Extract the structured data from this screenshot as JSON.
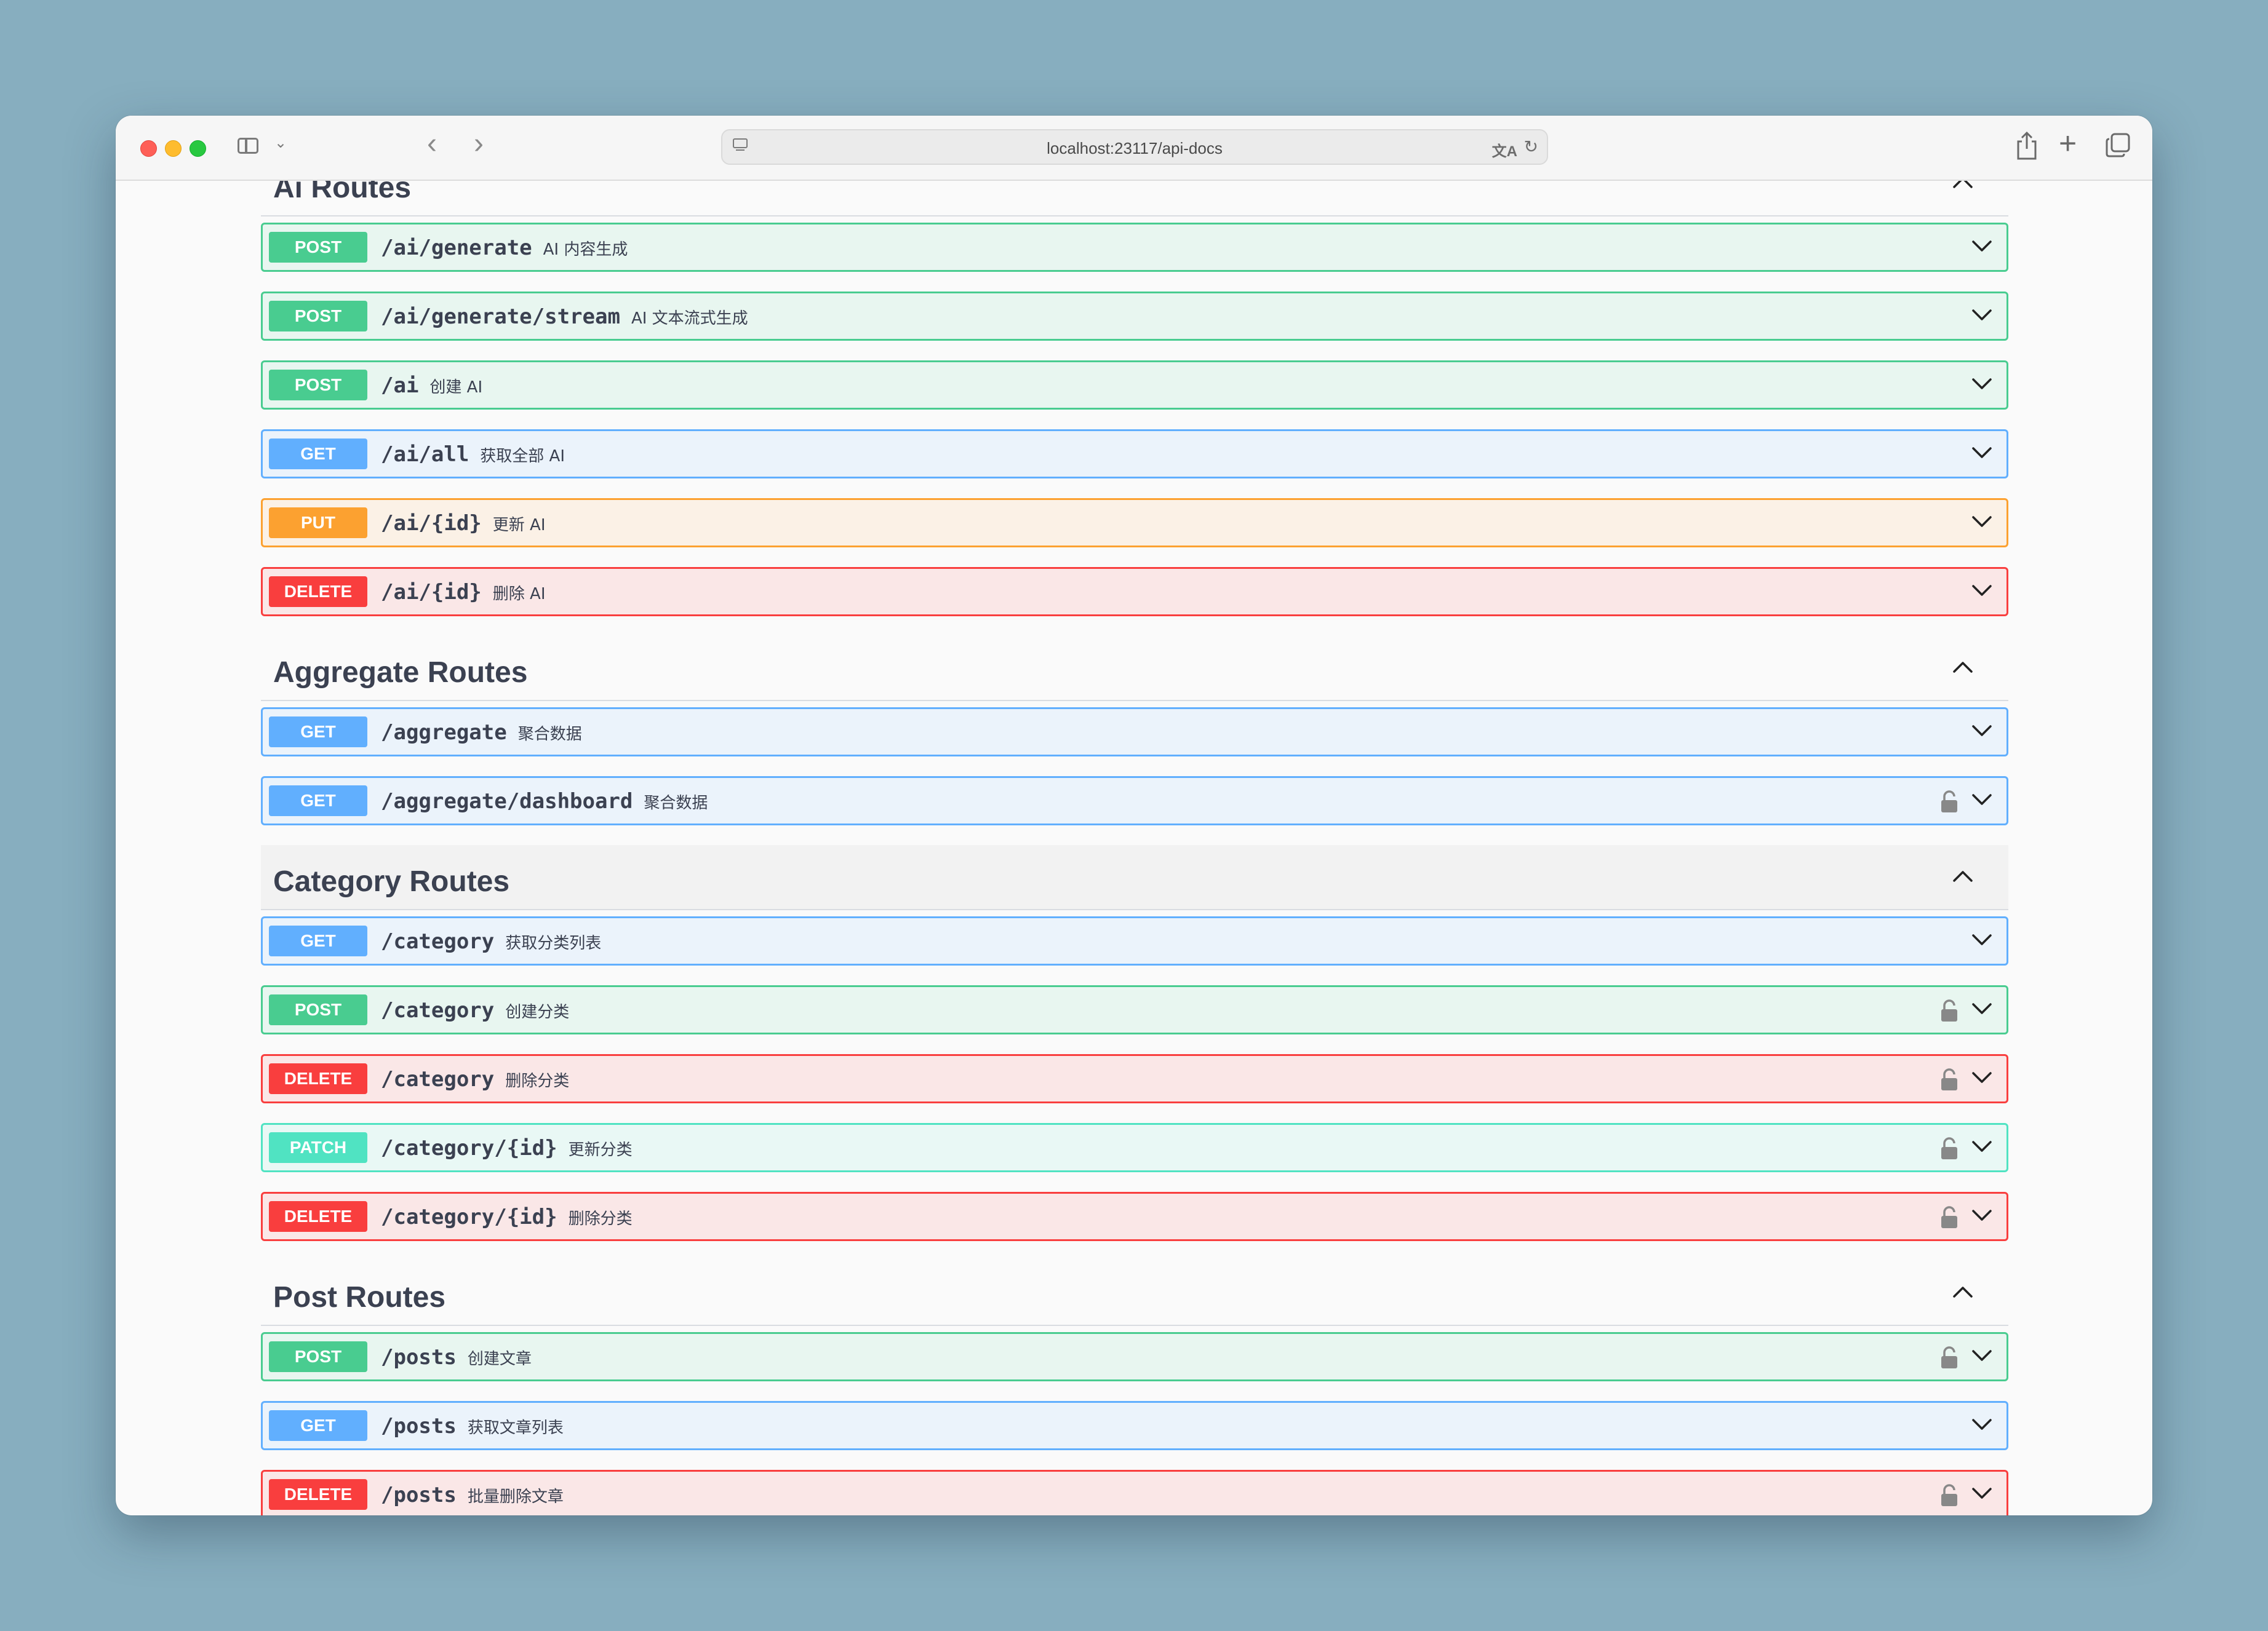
{
  "browser": {
    "url": "localhost:23117/api-docs",
    "icons": [
      "sidebar-icon",
      "chevron-down-icon",
      "back-icon",
      "forward-icon",
      "site-settings-icon",
      "translate-icon",
      "reload-icon",
      "share-icon",
      "new-tab-icon",
      "tabs-overview-icon"
    ]
  },
  "colors": {
    "post": "#49cc90",
    "get": "#61affe",
    "put": "#fca130",
    "delete": "#f93e3e",
    "patch": "#50e3c2",
    "title": "#3b4151",
    "desktop": "#87aebf"
  },
  "sections": [
    {
      "title": "Ai Routes",
      "operations": [
        {
          "method": "post",
          "label": "POST",
          "path": "/ai/generate",
          "summary": "AI 内容生成",
          "locked": false
        },
        {
          "method": "post",
          "label": "POST",
          "path": "/ai/generate/stream",
          "summary": "AI 文本流式生成",
          "locked": false
        },
        {
          "method": "post",
          "label": "POST",
          "path": "/ai",
          "summary": "创建 AI",
          "locked": false
        },
        {
          "method": "get",
          "label": "GET",
          "path": "/ai/all",
          "summary": "获取全部 AI",
          "locked": false
        },
        {
          "method": "put",
          "label": "PUT",
          "path": "/ai/{id}",
          "summary": "更新 AI",
          "locked": false
        },
        {
          "method": "delete",
          "label": "DELETE",
          "path": "/ai/{id}",
          "summary": "删除 AI",
          "locked": false
        }
      ]
    },
    {
      "title": "Aggregate Routes",
      "operations": [
        {
          "method": "get",
          "label": "GET",
          "path": "/aggregate",
          "summary": "聚合数据",
          "locked": false
        },
        {
          "method": "get",
          "label": "GET",
          "path": "/aggregate/dashboard",
          "summary": "聚合数据",
          "locked": true
        }
      ]
    },
    {
      "title": "Category Routes",
      "hovered": true,
      "operations": [
        {
          "method": "get",
          "label": "GET",
          "path": "/category",
          "summary": "获取分类列表",
          "locked": false
        },
        {
          "method": "post",
          "label": "POST",
          "path": "/category",
          "summary": "创建分类",
          "locked": true
        },
        {
          "method": "delete",
          "label": "DELETE",
          "path": "/category",
          "summary": "删除分类",
          "locked": true
        },
        {
          "method": "patch",
          "label": "PATCH",
          "path": "/category/{id}",
          "summary": "更新分类",
          "locked": true
        },
        {
          "method": "delete",
          "label": "DELETE",
          "path": "/category/{id}",
          "summary": "删除分类",
          "locked": true
        }
      ]
    },
    {
      "title": "Post Routes",
      "operations": [
        {
          "method": "post",
          "label": "POST",
          "path": "/posts",
          "summary": "创建文章",
          "locked": true
        },
        {
          "method": "get",
          "label": "GET",
          "path": "/posts",
          "summary": "获取文章列表",
          "locked": false
        },
        {
          "method": "delete",
          "label": "DELETE",
          "path": "/posts",
          "summary": "批量删除文章",
          "locked": true
        }
      ]
    }
  ]
}
